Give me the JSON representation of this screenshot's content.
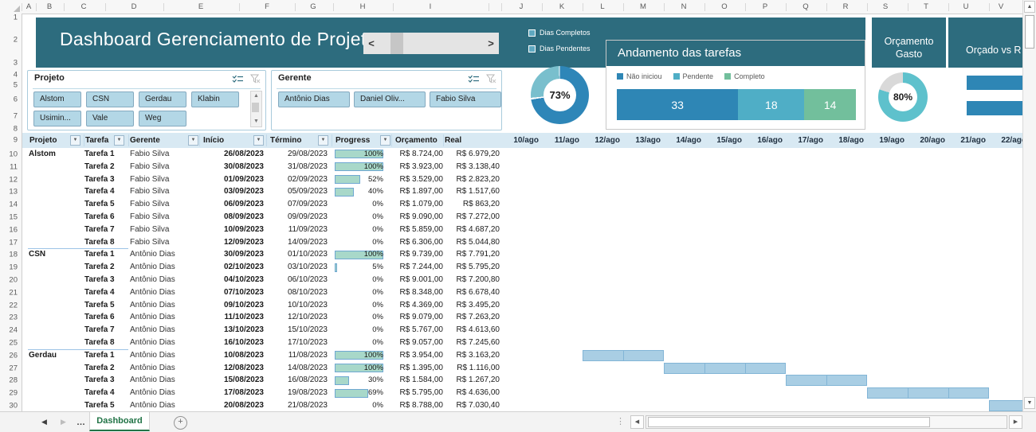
{
  "grid": {
    "col_letters": [
      "A",
      "B",
      "C",
      "D",
      "E",
      "F",
      "G",
      "H",
      "I",
      "J",
      "K",
      "L",
      "M",
      "N",
      "O",
      "P",
      "Q",
      "R",
      "S",
      "T",
      "U",
      "V"
    ],
    "row_numbers": [
      "1",
      "2",
      "3",
      "4",
      "5",
      "6",
      "7",
      "8",
      "9",
      "10",
      "11",
      "12",
      "13",
      "14",
      "15",
      "16",
      "17",
      "18",
      "19",
      "20",
      "21",
      "22",
      "23",
      "24",
      "25",
      "26",
      "27",
      "28",
      "29",
      "30"
    ]
  },
  "icons": {
    "up": "▲",
    "down": "▼",
    "left": "◀",
    "right": "▶",
    "angle_left": "<",
    "angle_right": ">",
    "dots": "⋮",
    "ellipsis": "…",
    "plus": "+",
    "dropdown": "▼"
  },
  "banner": {
    "title": "Dashboard Gerenciamento de Projeto"
  },
  "days_donut": {
    "legend": [
      "Dias Completos",
      "Dias Pendentes"
    ],
    "value_label": "73%",
    "pct": 73,
    "color_complete": "#2e86b8",
    "color_pending": "#79bfcd"
  },
  "slicers": [
    {
      "title": "Projeto",
      "items": [
        "Alstom",
        "CSN",
        "Gerdau",
        "Klabin",
        "Usimin...",
        "Vale",
        "Weg"
      ]
    },
    {
      "title": "Gerente",
      "items": [
        "Antônio Dias",
        "Daniel Oliv...",
        "Fabio Silva"
      ]
    }
  ],
  "tasks_chart": {
    "title": "Andamento das tarefas",
    "legend": [
      {
        "label": "Não iniciou",
        "color": "#2e86b5"
      },
      {
        "label": "Pendente",
        "color": "#4faec6"
      },
      {
        "label": "Completo",
        "color": "#72bf9c"
      }
    ],
    "values": [
      33,
      18,
      14
    ]
  },
  "budget_donut": {
    "title_line1": "Orçamento",
    "title_line2": "Gasto",
    "value_label": "80%",
    "pct": 80,
    "color": "#5ec1cc",
    "rest_color": "#d9d9d9"
  },
  "orcado_chart": {
    "title": "Orçado vs R",
    "bar_color": "#2e86b5"
  },
  "table": {
    "headers": [
      "Projeto",
      "Tarefa",
      "Gerente",
      "Início",
      "Término",
      "Progress",
      "Orçamento",
      "Real"
    ],
    "date_headers": [
      "10/ago",
      "11/ago",
      "12/ago",
      "13/ago",
      "14/ago",
      "15/ago",
      "16/ago",
      "17/ago",
      "18/ago",
      "19/ago",
      "20/ago",
      "21/ago",
      "22/ago"
    ],
    "rows": [
      {
        "projeto": "Alstom",
        "tarefa": "Tarefa 1",
        "gerente": "Fabio Silva",
        "inicio": "26/08/2023",
        "termino": "29/08/2023",
        "progress": 100,
        "orcamento": "R$ 8.724,00",
        "real": "R$ 6.979,20",
        "gantt": null
      },
      {
        "projeto": "",
        "tarefa": "Tarefa 2",
        "gerente": "Fabio Silva",
        "inicio": "30/08/2023",
        "termino": "31/08/2023",
        "progress": 100,
        "orcamento": "R$ 3.923,00",
        "real": "R$ 3.138,40",
        "gantt": null
      },
      {
        "projeto": "",
        "tarefa": "Tarefa 3",
        "gerente": "Fabio Silva",
        "inicio": "01/09/2023",
        "termino": "02/09/2023",
        "progress": 52,
        "orcamento": "R$ 3.529,00",
        "real": "R$ 2.823,20",
        "gantt": null
      },
      {
        "projeto": "",
        "tarefa": "Tarefa 4",
        "gerente": "Fabio Silva",
        "inicio": "03/09/2023",
        "termino": "05/09/2023",
        "progress": 40,
        "orcamento": "R$ 1.897,00",
        "real": "R$ 1.517,60",
        "gantt": null
      },
      {
        "projeto": "",
        "tarefa": "Tarefa 5",
        "gerente": "Fabio Silva",
        "inicio": "06/09/2023",
        "termino": "07/09/2023",
        "progress": 0,
        "orcamento": "R$ 1.079,00",
        "real": "R$ 863,20",
        "gantt": null
      },
      {
        "projeto": "",
        "tarefa": "Tarefa 6",
        "gerente": "Fabio Silva",
        "inicio": "08/09/2023",
        "termino": "09/09/2023",
        "progress": 0,
        "orcamento": "R$ 9.090,00",
        "real": "R$ 7.272,00",
        "gantt": null
      },
      {
        "projeto": "",
        "tarefa": "Tarefa 7",
        "gerente": "Fabio Silva",
        "inicio": "10/09/2023",
        "termino": "11/09/2023",
        "progress": 0,
        "orcamento": "R$ 5.859,00",
        "real": "R$ 4.687,20",
        "gantt": null
      },
      {
        "projeto": "",
        "tarefa": "Tarefa 8",
        "gerente": "Fabio Silva",
        "inicio": "12/09/2023",
        "termino": "14/09/2023",
        "progress": 0,
        "orcamento": "R$ 6.306,00",
        "real": "R$ 5.044,80",
        "gantt": null
      },
      {
        "projeto": "CSN",
        "tarefa": "Tarefa 1",
        "gerente": "Antônio Dias",
        "inicio": "30/09/2023",
        "termino": "01/10/2023",
        "progress": 100,
        "orcamento": "R$ 9.739,00",
        "real": "R$ 7.791,20",
        "gantt": null
      },
      {
        "projeto": "",
        "tarefa": "Tarefa 2",
        "gerente": "Antônio Dias",
        "inicio": "02/10/2023",
        "termino": "03/10/2023",
        "progress": 5,
        "orcamento": "R$ 7.244,00",
        "real": "R$ 5.795,20",
        "gantt": null
      },
      {
        "projeto": "",
        "tarefa": "Tarefa 3",
        "gerente": "Antônio Dias",
        "inicio": "04/10/2023",
        "termino": "06/10/2023",
        "progress": 0,
        "orcamento": "R$ 9.001,00",
        "real": "R$ 7.200,80",
        "gantt": null
      },
      {
        "projeto": "",
        "tarefa": "Tarefa 4",
        "gerente": "Antônio Dias",
        "inicio": "07/10/2023",
        "termino": "08/10/2023",
        "progress": 0,
        "orcamento": "R$ 8.348,00",
        "real": "R$ 6.678,40",
        "gantt": null
      },
      {
        "projeto": "",
        "tarefa": "Tarefa 5",
        "gerente": "Antônio Dias",
        "inicio": "09/10/2023",
        "termino": "10/10/2023",
        "progress": 0,
        "orcamento": "R$ 4.369,00",
        "real": "R$ 3.495,20",
        "gantt": null
      },
      {
        "projeto": "",
        "tarefa": "Tarefa 6",
        "gerente": "Antônio Dias",
        "inicio": "11/10/2023",
        "termino": "12/10/2023",
        "progress": 0,
        "orcamento": "R$ 9.079,00",
        "real": "R$ 7.263,20",
        "gantt": null
      },
      {
        "projeto": "",
        "tarefa": "Tarefa 7",
        "gerente": "Antônio Dias",
        "inicio": "13/10/2023",
        "termino": "15/10/2023",
        "progress": 0,
        "orcamento": "R$ 5.767,00",
        "real": "R$ 4.613,60",
        "gantt": null
      },
      {
        "projeto": "",
        "tarefa": "Tarefa 8",
        "gerente": "Antônio Dias",
        "inicio": "16/10/2023",
        "termino": "17/10/2023",
        "progress": 0,
        "orcamento": "R$ 9.057,00",
        "real": "R$ 7.245,60",
        "gantt": null
      },
      {
        "projeto": "Gerdau",
        "tarefa": "Tarefa 1",
        "gerente": "Antônio Dias",
        "inicio": "10/08/2023",
        "termino": "11/08/2023",
        "progress": 100,
        "orcamento": "R$ 3.954,00",
        "real": "R$ 3.163,20",
        "gantt": [
          2,
          3
        ]
      },
      {
        "projeto": "",
        "tarefa": "Tarefa 2",
        "gerente": "Antônio Dias",
        "inicio": "12/08/2023",
        "termino": "14/08/2023",
        "progress": 100,
        "orcamento": "R$ 1.395,00",
        "real": "R$ 1.116,00",
        "gantt": [
          4,
          6
        ]
      },
      {
        "projeto": "",
        "tarefa": "Tarefa 3",
        "gerente": "Antônio Dias",
        "inicio": "15/08/2023",
        "termino": "16/08/2023",
        "progress": 30,
        "orcamento": "R$ 1.584,00",
        "real": "R$ 1.267,20",
        "gantt": [
          7,
          8
        ]
      },
      {
        "projeto": "",
        "tarefa": "Tarefa 4",
        "gerente": "Antônio Dias",
        "inicio": "17/08/2023",
        "termino": "19/08/2023",
        "progress": 69,
        "orcamento": "R$ 5.795,00",
        "real": "R$ 4.636,00",
        "gantt": [
          9,
          11
        ]
      },
      {
        "projeto": "",
        "tarefa": "Tarefa 5",
        "gerente": "Antônio Dias",
        "inicio": "20/08/2023",
        "termino": "21/08/2023",
        "progress": 0,
        "orcamento": "R$ 8.788,00",
        "real": "R$ 7.030,40",
        "gantt": [
          12,
          12
        ]
      }
    ]
  },
  "window": {
    "sheet_tab": "Dashboard"
  }
}
